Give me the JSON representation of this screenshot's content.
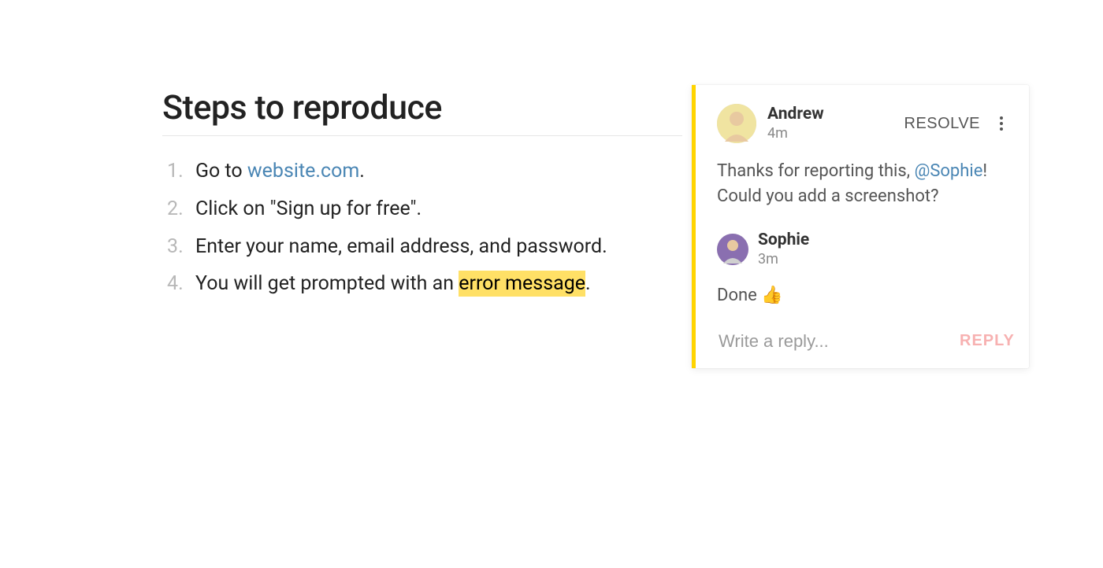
{
  "doc": {
    "title": "Steps to reproduce",
    "steps": {
      "s1_pre": "Go to ",
      "s1_link": "website.com",
      "s1_post": ".",
      "s2": "Click on \"Sign up for free\".",
      "s3": "Enter your name, email address, and password.",
      "s4_pre": "You will get prompted with an ",
      "s4_hl": "error message",
      "s4_post": "."
    }
  },
  "panel": {
    "resolve_label": "RESOLVE",
    "reply_action_label": "REPLY",
    "reply_placeholder": "Write a reply...",
    "comments": [
      {
        "author": "Andrew",
        "time": "4m",
        "body_pre": "Thanks for reporting this, ",
        "mention": "@Sophie",
        "body_post": "! Could you add a screenshot?"
      },
      {
        "author": "Sophie",
        "time": "3m",
        "body": "Done 👍"
      }
    ]
  },
  "colors": {
    "highlight": "#ffe066",
    "accent_bar": "#ffd400",
    "link": "#4a86b4",
    "reply_button": "#f7b1b1"
  }
}
